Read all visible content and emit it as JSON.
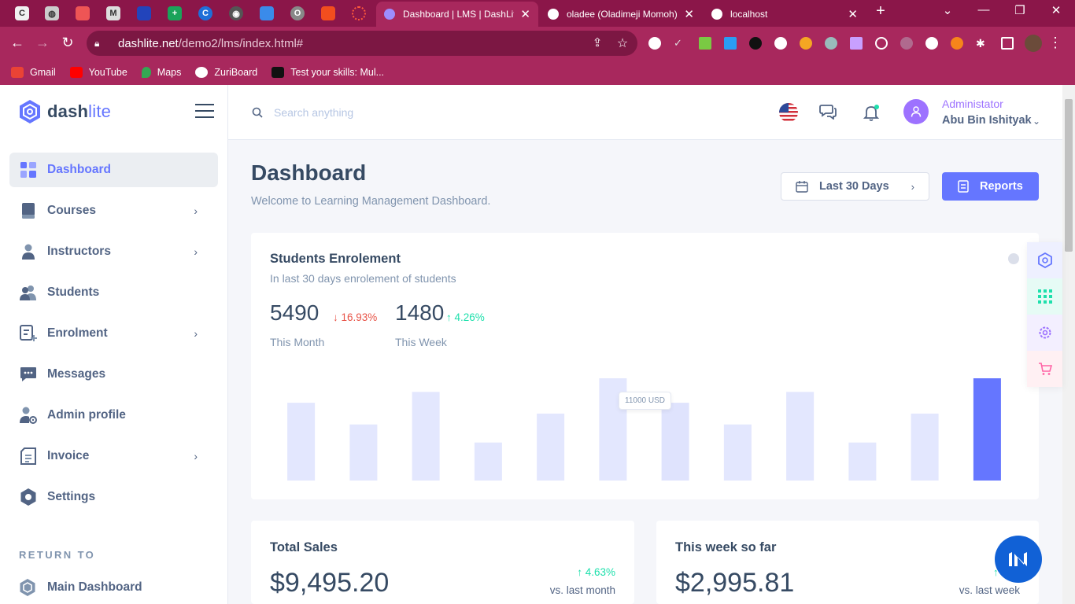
{
  "browser": {
    "tabs": [
      {
        "title": "Dashboard | LMS | DashLite",
        "active": true
      },
      {
        "title": "oladee (Oladimeji Momoh)",
        "active": false
      },
      {
        "title": "localhost",
        "active": false
      }
    ],
    "url_host": "dashlite.net",
    "url_path": "/demo2/lms/index.html#",
    "bookmarks": [
      "Gmail",
      "YouTube",
      "Maps",
      "ZuriBoard",
      "Test your skills: Mul..."
    ]
  },
  "sidebar": {
    "logo_dash": "dash",
    "logo_lite": "lite",
    "items": [
      {
        "label": "Dashboard",
        "icon": "dashboard-icon",
        "active": true
      },
      {
        "label": "Courses",
        "icon": "book-icon"
      },
      {
        "label": "Instructors",
        "icon": "user-icon"
      },
      {
        "label": "Students",
        "icon": "users-icon"
      },
      {
        "label": "Enrolment",
        "icon": "list-plus-icon"
      },
      {
        "label": "Messages",
        "icon": "chat-icon"
      },
      {
        "label": "Admin profile",
        "icon": "user-gear-icon"
      },
      {
        "label": "Invoice",
        "icon": "invoice-icon"
      },
      {
        "label": "Settings",
        "icon": "gear-icon"
      }
    ],
    "return_heading": "RETURN TO",
    "return_link": "Main Dashboard"
  },
  "header": {
    "search_placeholder": "Search anything",
    "user_role": "Administator",
    "user_name": "Abu Bin Ishityak"
  },
  "page": {
    "title": "Dashboard",
    "subtitle": "Welcome to Learning Management Dashboard.",
    "range_button": "Last 30 Days",
    "reports_button": "Reports"
  },
  "enrolment": {
    "title": "Students Enrolement",
    "subtitle": "In last 30 days enrolement of students",
    "month_value": "5490",
    "month_change": "16.93%",
    "month_label": "This Month",
    "week_value": "1480",
    "week_change": "4.26%",
    "week_label": "This Week",
    "tooltip": "11000 USD"
  },
  "chart_data": {
    "type": "bar",
    "values": [
      8.6,
      6.2,
      9.8,
      4.2,
      7.4,
      11.3,
      8.6,
      6.2,
      9.8,
      4.2,
      7.4,
      11.3
    ],
    "highlight_index": 11,
    "ylim": [
      0,
      11.3
    ],
    "colors": {
      "bar": "#e3e7fe",
      "hover": "#dfe3fd",
      "highlight": "#6576ff"
    }
  },
  "total_sales": {
    "title": "Total Sales",
    "amount": "$9,495.20",
    "change": "4.63%",
    "vs": "vs. last month"
  },
  "week_sales": {
    "title": "This week so far",
    "amount": "$2,995.81",
    "change": "7",
    "vs": "vs. last week"
  },
  "colors": {
    "accent": "#6576ff",
    "purple": "#9d72ff",
    "up": "#1ee0ac",
    "down": "#e85347"
  }
}
